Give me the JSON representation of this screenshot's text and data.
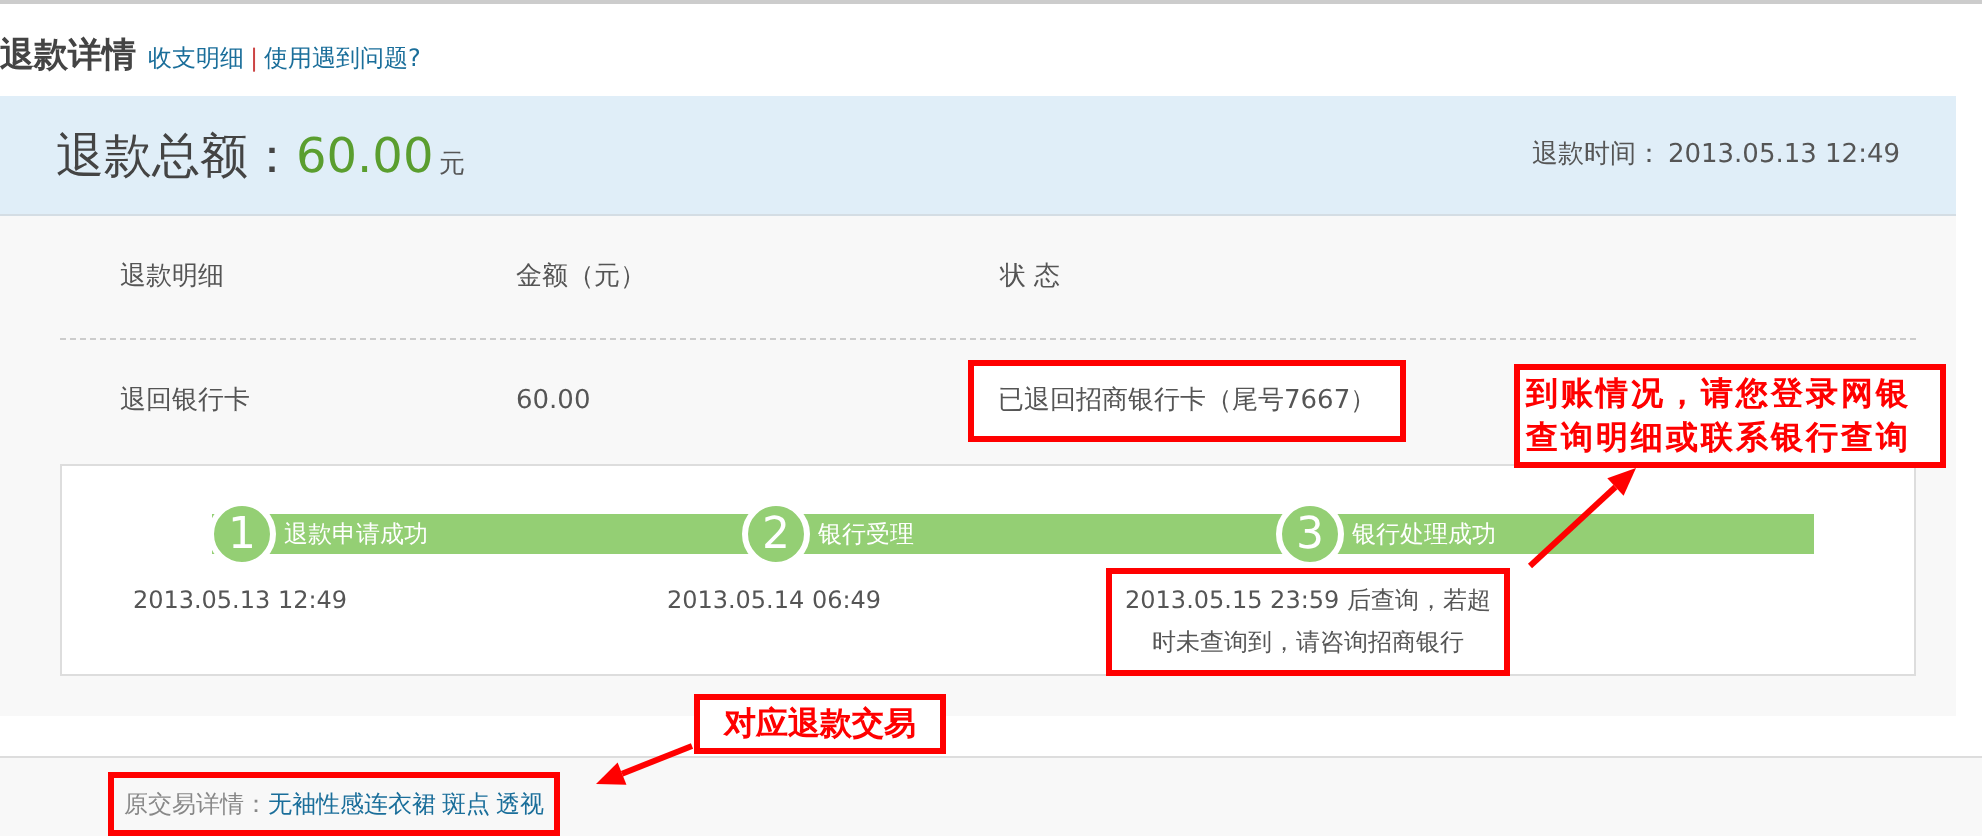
{
  "header": {
    "title": "退款详情",
    "links": [
      "收支明细",
      "使用遇到问题?"
    ],
    "separator": "|"
  },
  "summary": {
    "label": "退款总额：",
    "amount": "60.00",
    "unit": "元",
    "time_label": "退款时间：",
    "time": "2013.05.13 12:49"
  },
  "table": {
    "columns": [
      "退款明细",
      "金额（元）",
      "状 态"
    ],
    "rows": [
      {
        "cells": [
          "退回银行卡",
          "60.00",
          "已退回招商银行卡（尾号7667）"
        ],
        "status_highlighted": true
      }
    ]
  },
  "steps": [
    {
      "number": "1",
      "label": "退款申请成功",
      "time": "2013.05.13 12:49",
      "completed": true,
      "highlighted": false
    },
    {
      "number": "2",
      "label": "银行受理",
      "time": "2013.05.14 06:49",
      "completed": true,
      "highlighted": false
    },
    {
      "number": "3",
      "label": "银行处理成功",
      "time": "2013.05.15 23:59 后查询，若超时未查询到，请咨询招商银行",
      "completed": true,
      "highlighted": true
    }
  ],
  "original_trade": {
    "label": "原交易详情：",
    "links": [
      "无袖性感连衣裙",
      "斑点",
      "透视"
    ],
    "highlighted": true
  },
  "annotations": [
    {
      "kind": "status",
      "text": "到账情况，请您登录网银查询明细或联系银行查询"
    },
    {
      "kind": "trade",
      "text": "对应退款交易"
    }
  ]
}
